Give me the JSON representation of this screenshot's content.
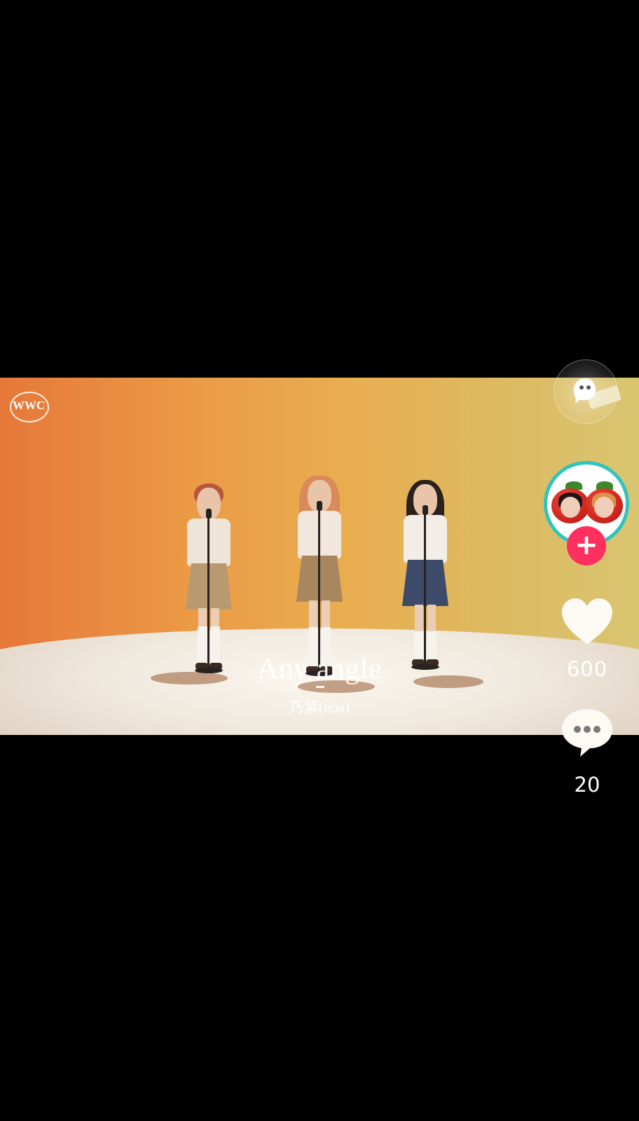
{
  "video": {
    "watermark_logo": "WWC",
    "song_title": "Any angle",
    "artist": "乃紫(noa)"
  },
  "actions": {
    "like_count": "600",
    "comment_count": "20",
    "follow_symbol": "+"
  },
  "icons": {
    "music_disc": "music-disc-icon",
    "like": "heart-icon",
    "comment": "comment-bubble-icon",
    "follow": "plus-icon"
  },
  "colors": {
    "background": "#000000",
    "follow_button": "#ff2f5f",
    "avatar_ring": "#2ec4bf",
    "icon_white": "#fdf9f3"
  }
}
